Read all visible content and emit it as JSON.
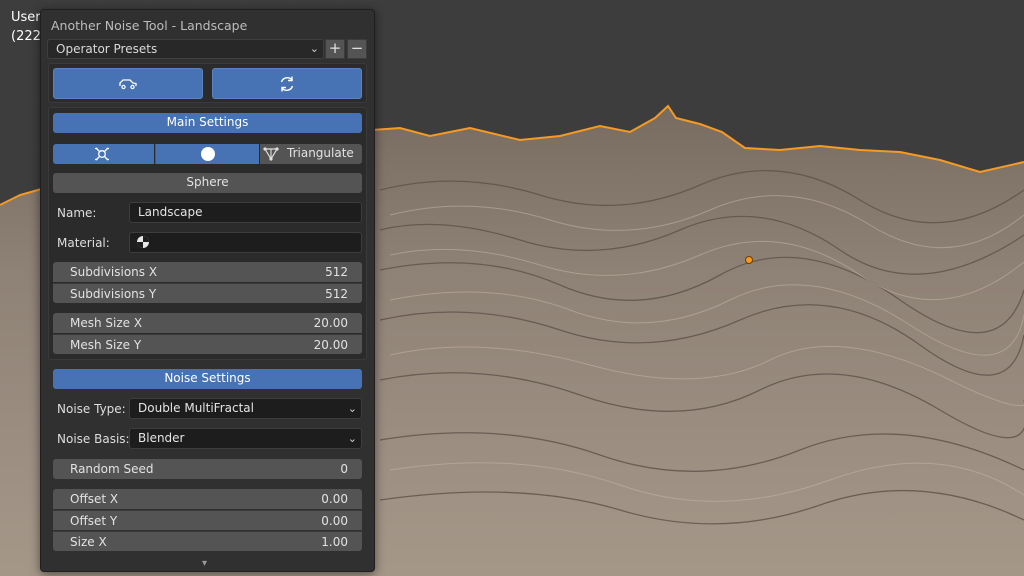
{
  "viewport": {
    "mode_label": "User",
    "count_label": "(222)"
  },
  "panel": {
    "title": "Another Noise Tool - Landscape",
    "presets": {
      "value": "Operator Presets",
      "add": "+",
      "remove": "−"
    },
    "main_settings": "Main Settings",
    "triangulate": "Triangulate",
    "sphere": "Sphere",
    "name_label": "Name:",
    "name_value": "Landscape",
    "material_label": "Material:",
    "subdivisions": [
      {
        "label": "Subdivisions X",
        "value": "512"
      },
      {
        "label": "Subdivisions Y",
        "value": "512"
      }
    ],
    "mesh_size": [
      {
        "label": "Mesh Size X",
        "value": "20.00"
      },
      {
        "label": "Mesh Size Y",
        "value": "20.00"
      }
    ],
    "noise_settings": "Noise Settings",
    "noise_type_label": "Noise Type:",
    "noise_type_value": "Double MultiFractal",
    "noise_basis_label": "Noise Basis:",
    "noise_basis_value": "Blender",
    "random_seed": {
      "label": "Random Seed",
      "value": "0"
    },
    "offsets": [
      {
        "label": "Offset X",
        "value": "0.00"
      },
      {
        "label": "Offset Y",
        "value": "0.00"
      },
      {
        "label": "Size X",
        "value": "1.00"
      }
    ],
    "scroll_indicator": "▾"
  },
  "colors": {
    "accent_blue": "#4772b3",
    "panel_bg": "#303030",
    "terrain": "#8b7e72",
    "selection_outline": "#f59a23"
  }
}
